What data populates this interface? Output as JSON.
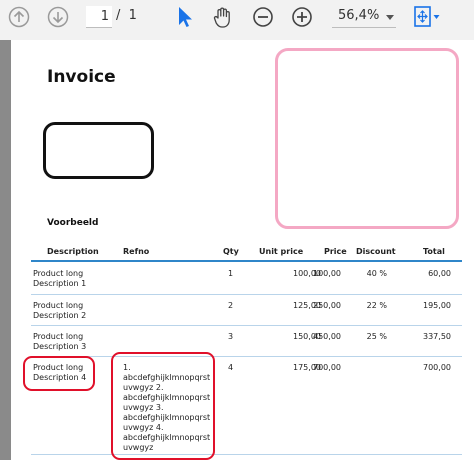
{
  "toolbar": {
    "current_page": "1",
    "page_total": "/  1",
    "zoom": "56,4%",
    "icons": [
      "arrow-up-icon",
      "arrow-down-icon",
      "select-cursor-icon",
      "hand-pan-icon",
      "zoom-out-icon",
      "zoom-in-icon",
      "fit-page-icon"
    ]
  },
  "document": {
    "title": "Invoice",
    "reference_label": "Voorbeeld",
    "columns": [
      "Description",
      "Refno",
      "Qty",
      "Unit price",
      "Price",
      "Discount",
      "Total"
    ],
    "rows": [
      {
        "description": "Product long\nDescription 1",
        "refno": "",
        "qty": "1",
        "unit_price": "100,00",
        "price": "100,00",
        "discount": "40 %",
        "total": "60,00"
      },
      {
        "description": "Product long\nDescription 2",
        "refno": "",
        "qty": "2",
        "unit_price": "125,00",
        "price": "250,00",
        "discount": "22 %",
        "total": "195,00"
      },
      {
        "description": "Product long\nDescription 3",
        "refno": "",
        "qty": "3",
        "unit_price": "150,00",
        "price": "450,00",
        "discount": "25 %",
        "total": "337,50"
      },
      {
        "description": "Product long\nDescription 4",
        "refno": "1.\nabcdefghijklmnopqrst\nuvwgyz 2.\nabcdefghijklmnopqrst\nuvwgyz 3.\nabcdefghijklmnopqrst\nuvwgyz 4.\nabcdefghijklmnopqrst\nuvwgyz",
        "qty": "4",
        "unit_price": "175,00",
        "price": "700,00",
        "discount": "",
        "total": "700,00"
      }
    ]
  },
  "colors": {
    "accent_blue": "#2f86c9",
    "highlight_red": "#e0102a",
    "address_pink": "#f4a8c4",
    "toolbar_blue": "#1a73e8"
  }
}
